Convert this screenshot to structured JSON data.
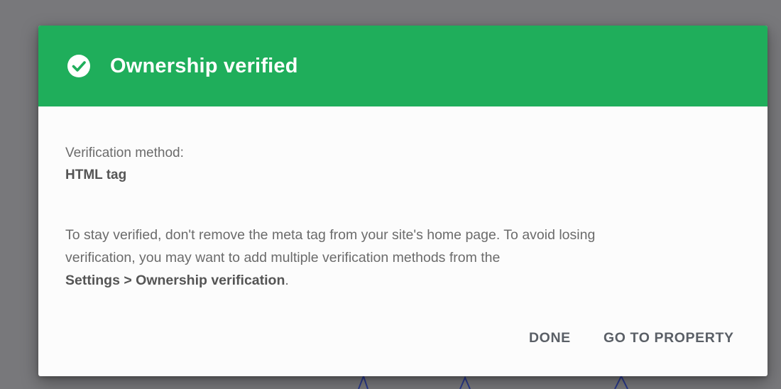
{
  "dialog": {
    "title": "Ownership verified",
    "header_color": "#1fae5b",
    "header_icon": "check-circle-icon",
    "method_label": "Verification method:",
    "method_value": "HTML tag",
    "info_line1": "To stay verified, don't remove the meta tag from your site's home page. To avoid losing",
    "info_line2": "verification, you may want to add multiple verification methods from the",
    "info_link": "Settings > Ownership verification",
    "info_end": ".",
    "buttons": {
      "done": "DONE",
      "go_to_property": "GO TO PROPERTY"
    }
  }
}
